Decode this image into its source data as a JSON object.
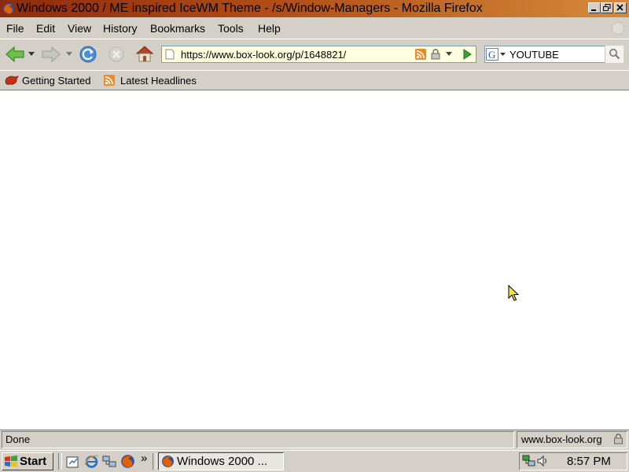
{
  "window": {
    "title": "Windows 2000 / ME inspired IceWM Theme - /s/Window-Managers - Mozilla Firefox"
  },
  "menu": {
    "items": [
      {
        "label": "File"
      },
      {
        "label": "Edit"
      },
      {
        "label": "View"
      },
      {
        "label": "History"
      },
      {
        "label": "Bookmarks"
      },
      {
        "label": "Tools"
      },
      {
        "label": "Help"
      }
    ]
  },
  "navigation": {
    "url": "https://www.box-look.org/p/1648821/",
    "search_value": "YOUTUBE",
    "search_engine_icon": "google-icon"
  },
  "bookmarks": {
    "items": [
      {
        "label": "Getting Started",
        "icon": "firefox-bookmark-icon"
      },
      {
        "label": "Latest Headlines",
        "icon": "rss-feed-icon"
      }
    ]
  },
  "status": {
    "text": "Done",
    "domain": "www.box-look.org"
  },
  "taskbar": {
    "start_label": "Start",
    "task_label": "Windows 2000 ...",
    "overflow_label": "»",
    "clock": "8:57 PM"
  },
  "colors": {
    "titlebar_left": "#8f2a0c",
    "titlebar_right": "#d58a3a",
    "chrome": "#d4d0c8",
    "urlbar": "#ffffe1"
  }
}
